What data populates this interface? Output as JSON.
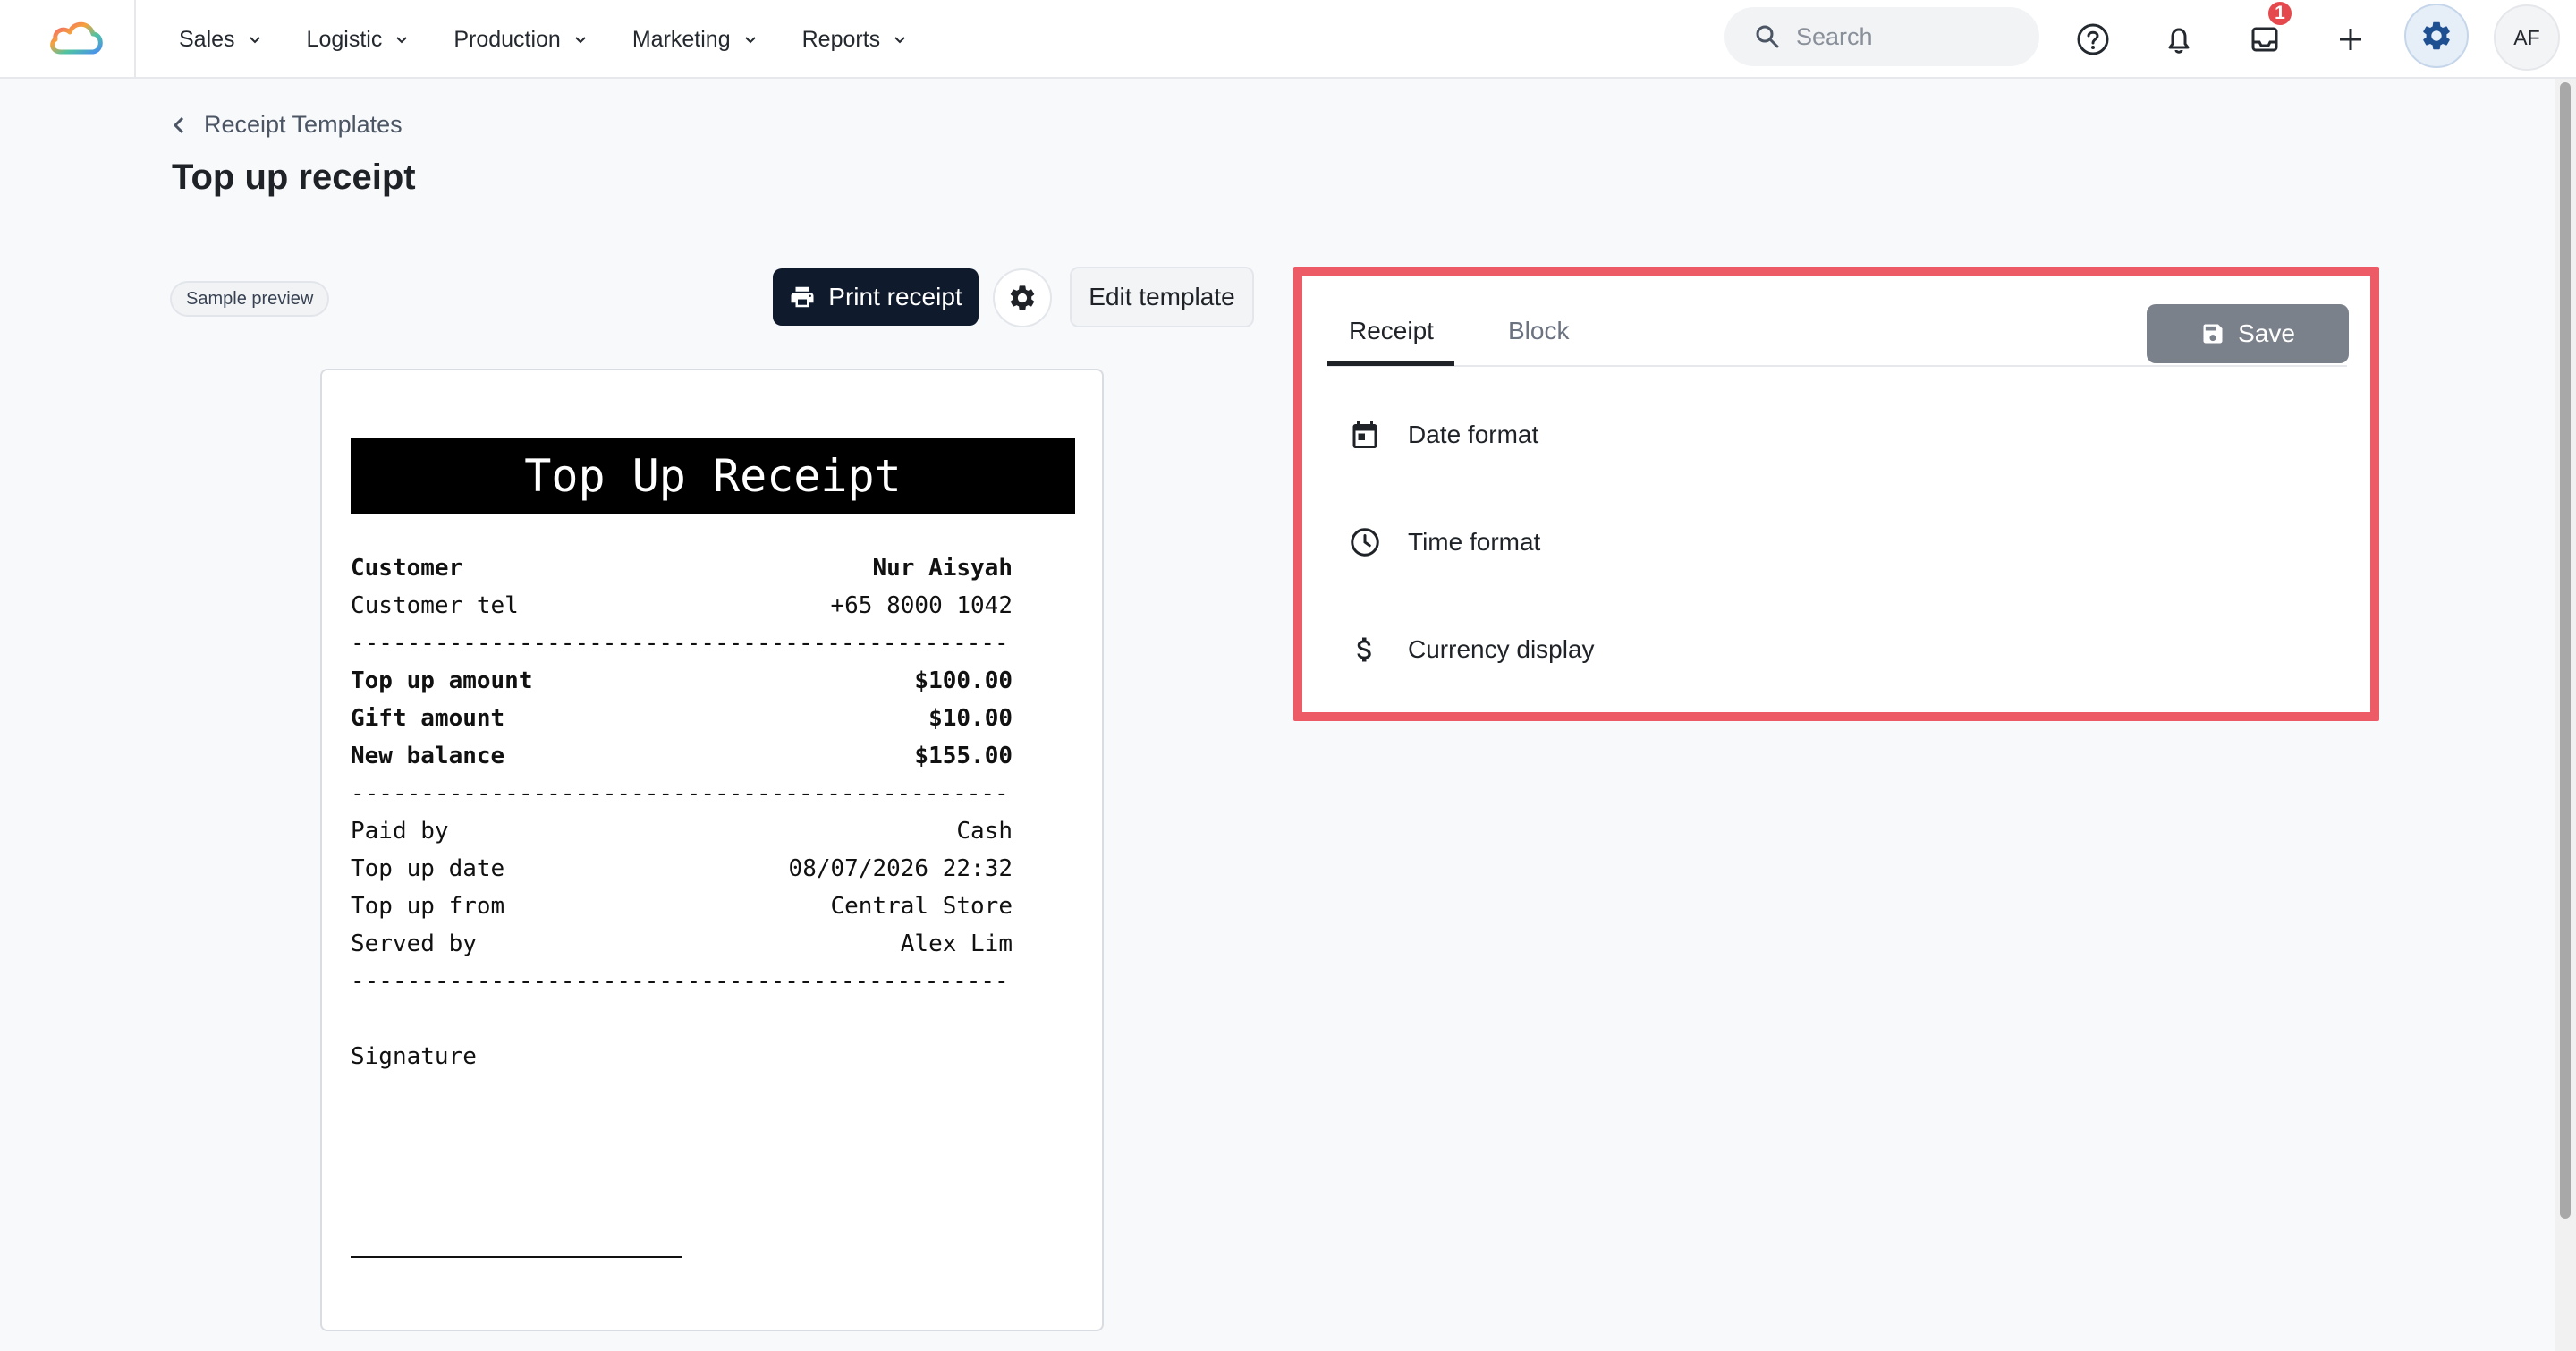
{
  "nav": {
    "menu": [
      {
        "label": "Sales"
      },
      {
        "label": "Logistic"
      },
      {
        "label": "Production"
      },
      {
        "label": "Marketing"
      },
      {
        "label": "Reports"
      }
    ],
    "search_placeholder": "Search",
    "inbox_badge": "1",
    "avatar_initials": "AF"
  },
  "breadcrumb": {
    "label": "Receipt Templates"
  },
  "page": {
    "title": "Top up receipt"
  },
  "toolbar": {
    "sample_label": "Sample preview",
    "print_label": "Print receipt",
    "edit_label": "Edit template"
  },
  "receipt": {
    "header": "Top Up Receipt",
    "separator": "-----------------------------------------------",
    "customer": {
      "label": "Customer",
      "value": "Nur Aisyah"
    },
    "customer_tel": {
      "label": "Customer tel",
      "value": "+65 8000 1042"
    },
    "top_up_amount": {
      "label": "Top up amount",
      "value": "$100.00"
    },
    "gift_amount": {
      "label": "Gift amount",
      "value": "$10.00"
    },
    "new_balance": {
      "label": "New balance",
      "value": "$155.00"
    },
    "paid_by": {
      "label": "Paid by",
      "value": "Cash"
    },
    "top_up_date": {
      "label": "Top up date",
      "value": "08/07/2026 22:32"
    },
    "top_up_from": {
      "label": "Top up from",
      "value": "Central Store"
    },
    "served_by": {
      "label": "Served by",
      "value": "Alex Lim"
    },
    "signature_label": "Signature"
  },
  "settings": {
    "tabs": [
      {
        "label": "Receipt"
      },
      {
        "label": "Block"
      }
    ],
    "save_label": "Save",
    "rows": [
      {
        "label": "Date format",
        "icon": "calendar-icon"
      },
      {
        "label": "Time format",
        "icon": "clock-icon"
      },
      {
        "label": "Currency display",
        "icon": "dollar-icon"
      }
    ]
  },
  "colors": {
    "highlight": "#ec5b66",
    "primary_dark": "#0f1b2d",
    "save_disabled": "#7b818a",
    "badge": "#e5484d"
  }
}
